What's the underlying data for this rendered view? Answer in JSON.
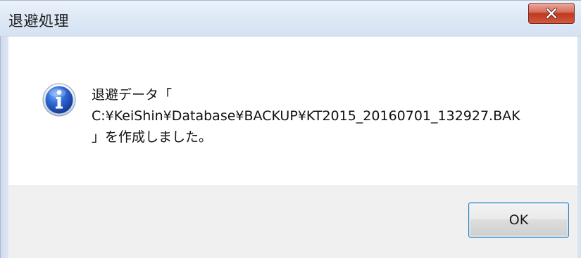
{
  "window": {
    "title": "退避処理",
    "close_icon": "close-x-icon"
  },
  "message": {
    "icon": "information-icon",
    "icon_colors": {
      "circle": "#2a62c9",
      "glyph": "#ffffff"
    },
    "line1": "退避データ「",
    "line2": "C:¥KeiShin¥Database¥BACKUP¥KT2015_20160701_132927.BAK",
    "line3": "」を作成しました。"
  },
  "buttons": {
    "ok_label": "OK"
  },
  "colors": {
    "close_button": "#c0391f",
    "ok_border": "#3c7fb1",
    "footer_background": "#f0f0f0"
  }
}
